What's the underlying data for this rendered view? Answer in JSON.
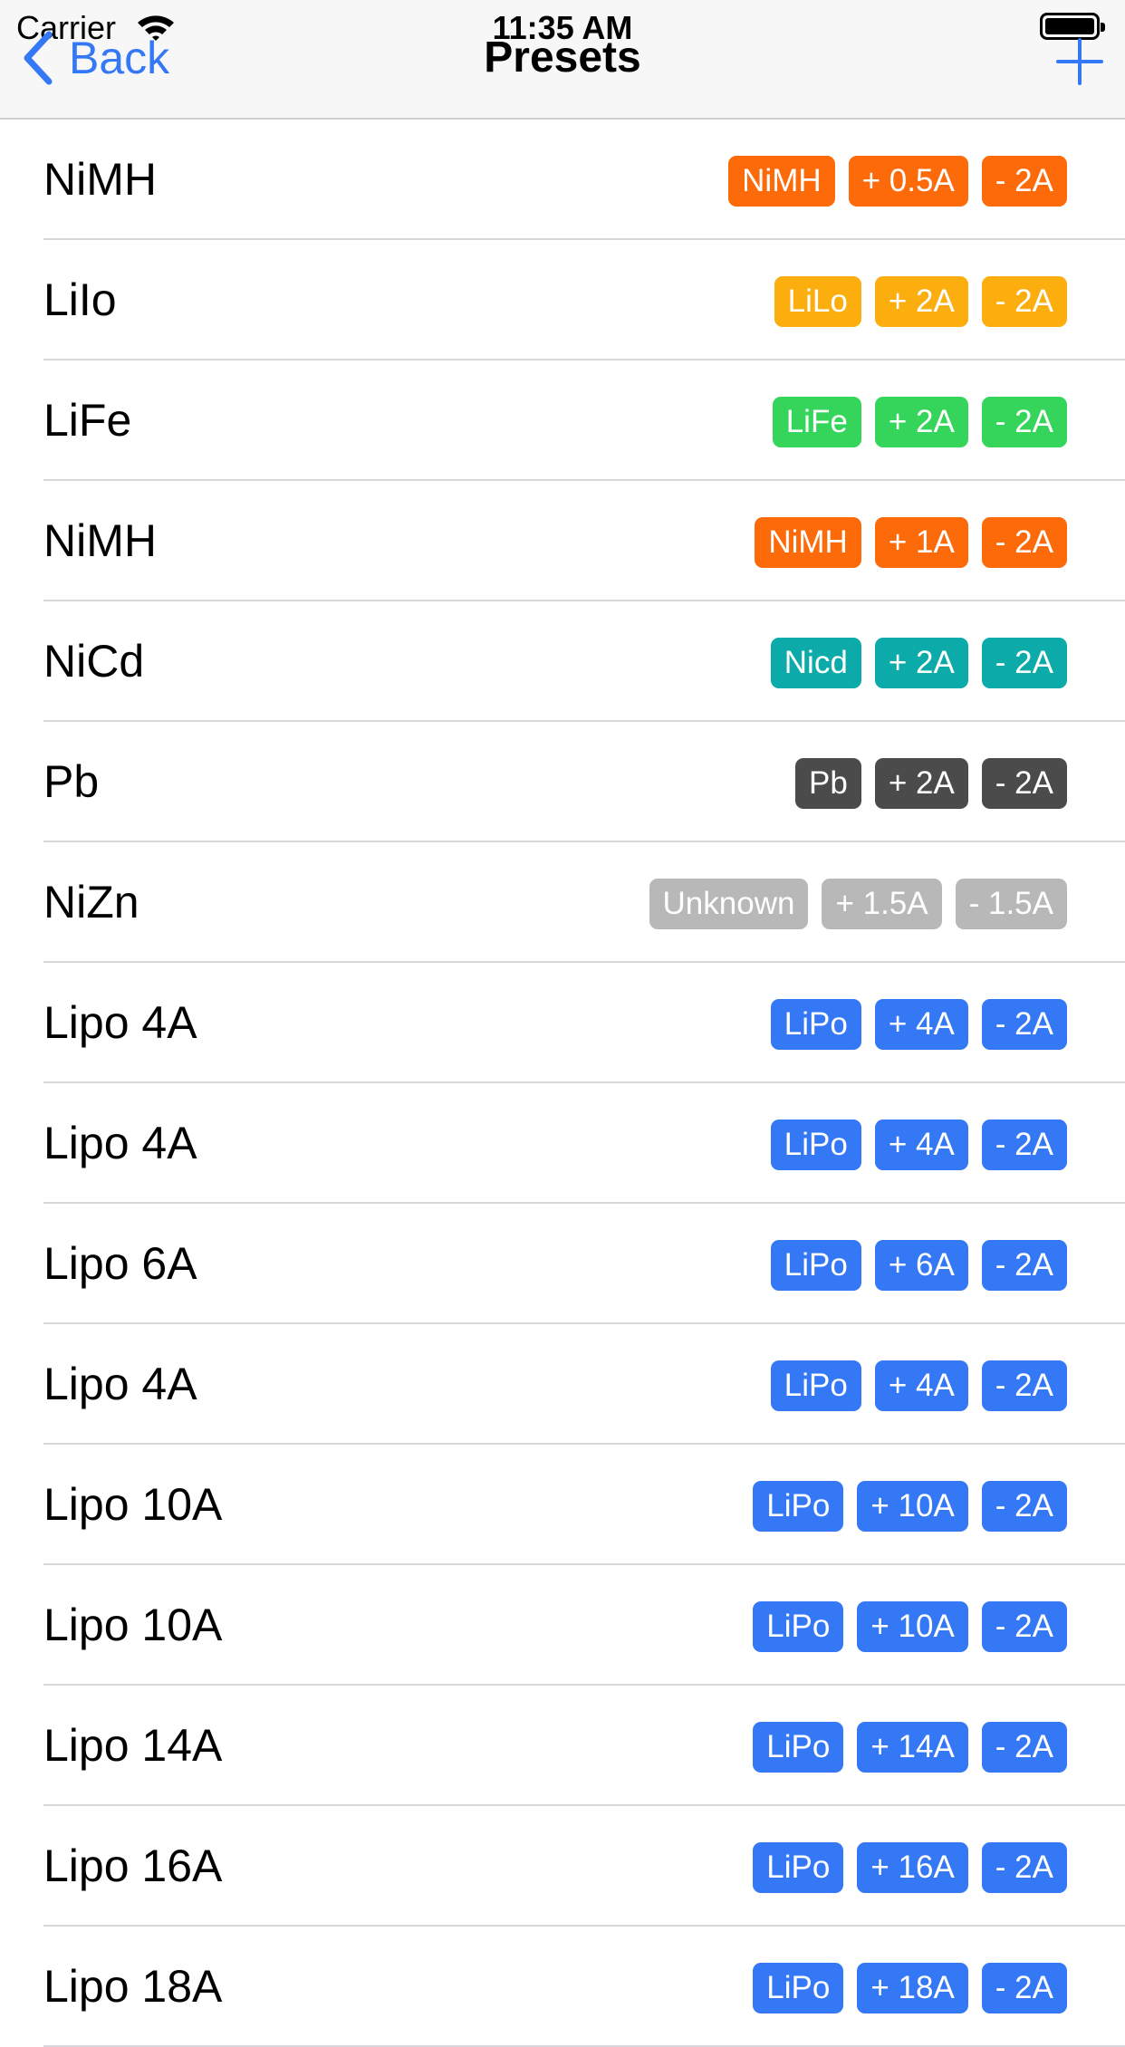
{
  "status": {
    "carrier": "Carrier",
    "time": "11:35 AM"
  },
  "nav": {
    "back_label": "Back",
    "title": "Presets",
    "add_icon": "plus-icon"
  },
  "colors": {
    "orange": "#fd6a0a",
    "amber": "#fcae0f",
    "green": "#35d45a",
    "teal": "#0cabaa",
    "dark": "#4b4b4b",
    "gray": "#b8b8b8",
    "blue": "#3478f6",
    "tint": "#3478f6"
  },
  "presets": [
    {
      "name": "NiMH",
      "color": "#fd6a0a",
      "type": "NiMH",
      "charge": "+ 0.5A",
      "discharge": "- 2A"
    },
    {
      "name": "LiIo",
      "color": "#fcae0f",
      "type": "LiLo",
      "charge": "+ 2A",
      "discharge": "- 2A"
    },
    {
      "name": "LiFe",
      "color": "#35d45a",
      "type": "LiFe",
      "charge": "+ 2A",
      "discharge": "- 2A"
    },
    {
      "name": "NiMH",
      "color": "#fd6a0a",
      "type": "NiMH",
      "charge": "+ 1A",
      "discharge": "- 2A"
    },
    {
      "name": "NiCd",
      "color": "#0cabaa",
      "type": "Nicd",
      "charge": "+ 2A",
      "discharge": "- 2A"
    },
    {
      "name": "Pb",
      "color": "#4b4b4b",
      "type": "Pb",
      "charge": "+ 2A",
      "discharge": "- 2A"
    },
    {
      "name": "NiZn",
      "color": "#b8b8b8",
      "type": "Unknown",
      "charge": "+ 1.5A",
      "discharge": "- 1.5A"
    },
    {
      "name": "Lipo 4A",
      "color": "#3478f6",
      "type": "LiPo",
      "charge": "+ 4A",
      "discharge": "- 2A"
    },
    {
      "name": "Lipo 4A",
      "color": "#3478f6",
      "type": "LiPo",
      "charge": "+ 4A",
      "discharge": "- 2A"
    },
    {
      "name": "Lipo 6A",
      "color": "#3478f6",
      "type": "LiPo",
      "charge": "+ 6A",
      "discharge": "- 2A"
    },
    {
      "name": "Lipo 4A",
      "color": "#3478f6",
      "type": "LiPo",
      "charge": "+ 4A",
      "discharge": "- 2A"
    },
    {
      "name": "Lipo 10A",
      "color": "#3478f6",
      "type": "LiPo",
      "charge": "+ 10A",
      "discharge": "- 2A"
    },
    {
      "name": "Lipo 10A",
      "color": "#3478f6",
      "type": "LiPo",
      "charge": "+ 10A",
      "discharge": "- 2A"
    },
    {
      "name": "Lipo 14A",
      "color": "#3478f6",
      "type": "LiPo",
      "charge": "+ 14A",
      "discharge": "- 2A"
    },
    {
      "name": "Lipo 16A",
      "color": "#3478f6",
      "type": "LiPo",
      "charge": "+ 16A",
      "discharge": "- 2A"
    },
    {
      "name": "Lipo 18A",
      "color": "#3478f6",
      "type": "LiPo",
      "charge": "+ 18A",
      "discharge": "- 2A"
    }
  ]
}
